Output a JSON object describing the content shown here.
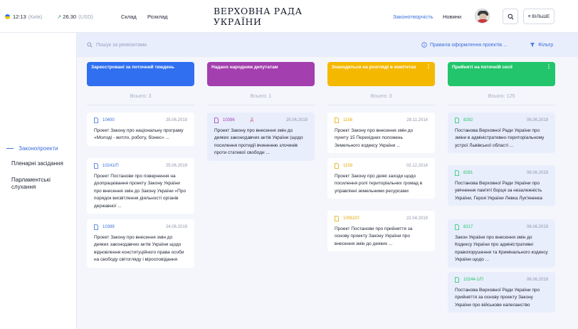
{
  "header": {
    "time": "12:13",
    "city": "(Київ)",
    "rate": "26.30",
    "currency": "(USD)",
    "nav_sklad": "Склад",
    "nav_rozklad": "Розклад",
    "title": "ВЕРХОВНА РАДА УКРАЇНИ",
    "nav_zakonotvorchist": "Законотворчість",
    "nav_novyny": "Новини",
    "more_label": "≡ ВІЛЬШЕ",
    "colors": {
      "accent": "#3c6fd8",
      "rate_up": "#2f9e59"
    }
  },
  "sidebar": {
    "items": [
      {
        "label": "Законопроекти"
      },
      {
        "label": "Пленарні засідання"
      },
      {
        "label": "Парламентські слухання"
      }
    ]
  },
  "toolbar": {
    "search_placeholder": "Пошук за реквізитами",
    "rules_label": "Правила оформлення проектів ...",
    "filter_label": "Фільтр"
  },
  "columns": [
    {
      "title": "Зареєстровані за поточний тиждень",
      "color": "#2f6ff0",
      "total": "Всього: 3",
      "cards": [
        {
          "number": "10400",
          "date": "25.06.2019",
          "text": "Проект Закону про національну програму «Молоді - житло, роботу, бізнес» ..."
        },
        {
          "number": "10241/П",
          "date": "25.06.2019",
          "text": "Проект Постанови про повернення на доопрацювання проекту Закону України про внесення змін до Закону України «Про порядок висвітлення діяльності органів державної ..."
        },
        {
          "number": "10399",
          "date": "24.06.2019",
          "text": "Проект Закону про внесення змін до деяких законодавчих актів України щодо відновлення конституційного права особи на свободу світогляду і віросповідання"
        }
      ]
    },
    {
      "title": "Надано народним депутатам",
      "color": "#a33fae",
      "total": "Всього: 1",
      "cards": [
        {
          "number": "10396",
          "flag": "Д",
          "date": "25.06.2019",
          "text": "Проект Закону про внесення змін до деяких законодавчих актів України (щодо посилення протидії вчиненню злочинів проти статевої свободи ..."
        }
      ]
    },
    {
      "title": "Знаходяться на розгляді в комітетах",
      "color": "#f5b800",
      "total": "Всього: 3",
      "cards": [
        {
          "number": "1158",
          "date": "28.11.2014",
          "text": "Проект Закону про внесення змін до пункту 15 Перехідних положень Земельного кодексу України ..."
        },
        {
          "number": "1159",
          "date": "02.12.2014",
          "text": "Проект Закону про деякі заходи щодо посилення ролі територіальних громад в управлінні земельними ресурсами"
        },
        {
          "number": "10052/П",
          "date": "22.04.2019",
          "text": "Проект Постанови про прийняття за основу проекту Закону України про внесення змін до деяких ..."
        }
      ]
    },
    {
      "title": "Прийняті на поточній сесії",
      "color": "#22c56b",
      "total": "Всього: 125",
      "cards": [
        {
          "number": "8292",
          "date": "06.06.2019",
          "text": "Постанова Верховної Ради України про зміни в адміністративно-територіальному устрої Львівської області ..."
        },
        {
          "number": "8281",
          "date": "06.06.2019",
          "text": "Постанова Верховної Ради України про увічнення пам'яті борця за незалежність України, Героя України Левка Лук'яненка"
        },
        {
          "number": "8217",
          "date": "06.06.2019",
          "text": "Закон України про внесення змін до Кодексу України про адміністративні правопорушення та Кримінального кодексу України щодо ..."
        },
        {
          "number": "10244-1/П",
          "date": "06.06.2019",
          "text": "Постанова Верховної Ради України про прийняття за основу проекту Закону України про військове капеланство"
        }
      ]
    }
  ]
}
